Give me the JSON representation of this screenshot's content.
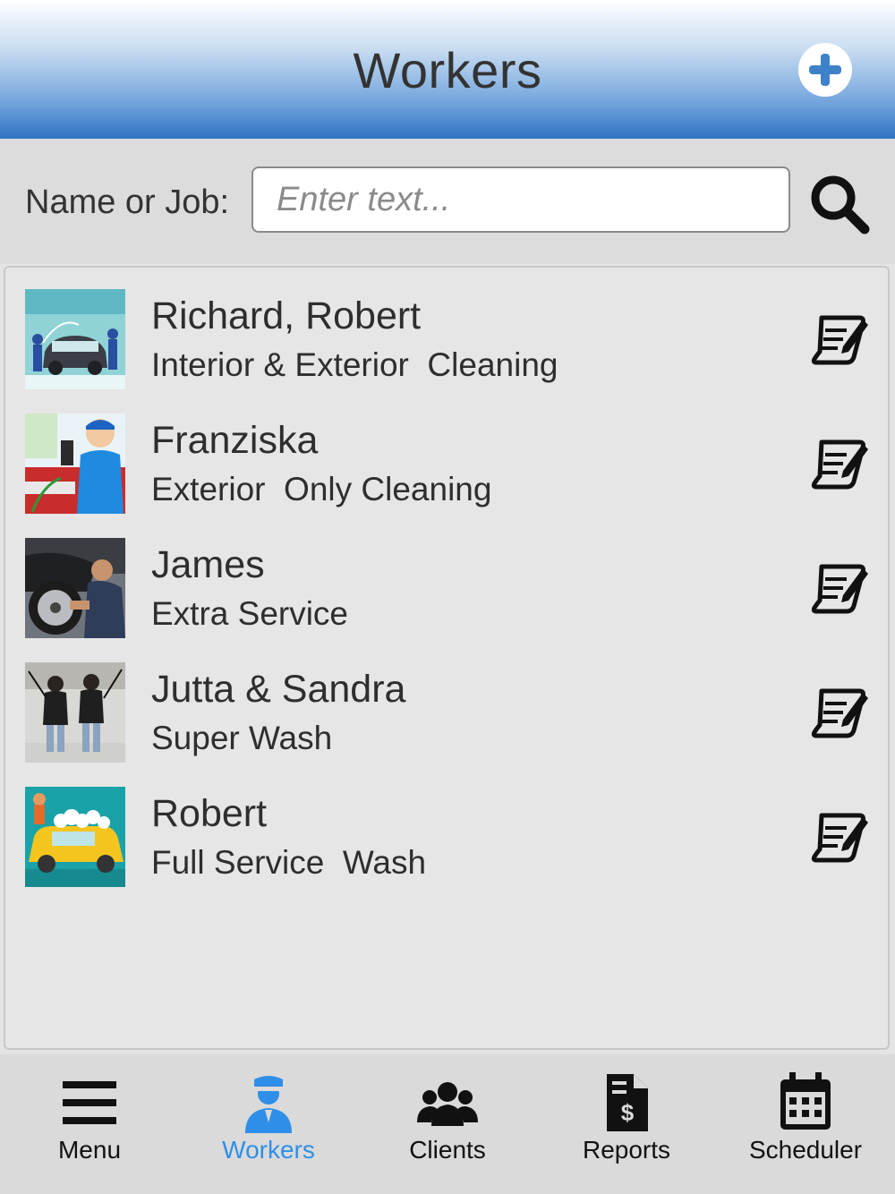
{
  "header": {
    "title": "Workers",
    "add_icon": "plus-circle-icon"
  },
  "search": {
    "label": "Name or Job:",
    "placeholder": "Enter text...",
    "value": "",
    "icon": "magnifier-icon"
  },
  "workers": [
    {
      "name": "Richard, Robert",
      "job": "Interior & Exterior  Cleaning",
      "photo": "car-wash-illustration"
    },
    {
      "name": "Franziska",
      "job": "Exterior  Only Cleaning",
      "photo": "cartoon-worker-washing-car"
    },
    {
      "name": "James",
      "job": "Extra Service",
      "photo": "man-cleaning-wheel"
    },
    {
      "name": "Jutta & Sandra",
      "job": "Super Wash",
      "photo": "two-women-pressure-washers"
    },
    {
      "name": "Robert",
      "job": "Full Service  Wash",
      "photo": "yellow-car-foam-wash"
    }
  ],
  "tabs": [
    {
      "label": "Menu",
      "icon": "hamburger-icon",
      "active": false
    },
    {
      "label": "Workers",
      "icon": "worker-icon",
      "active": true
    },
    {
      "label": "Clients",
      "icon": "group-icon",
      "active": false
    },
    {
      "label": "Reports",
      "icon": "invoice-icon",
      "active": false
    },
    {
      "label": "Scheduler",
      "icon": "calendar-icon",
      "active": false
    }
  ],
  "colors": {
    "active_tab": "#2f8fe8",
    "header_blue": "#2e73c2"
  }
}
